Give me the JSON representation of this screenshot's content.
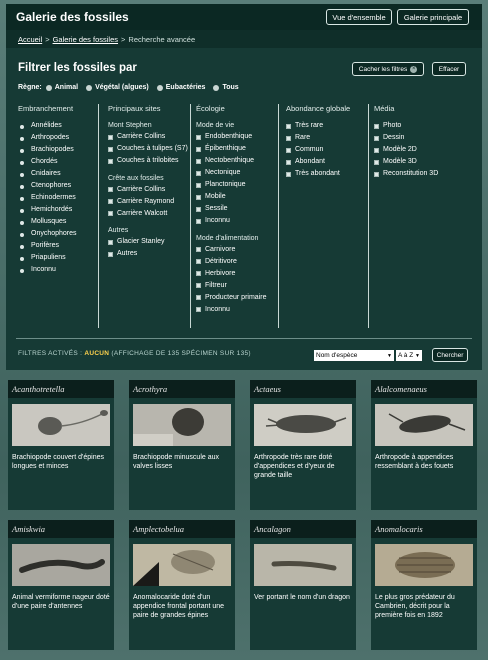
{
  "header": {
    "title": "Galerie des fossiles",
    "btn_overview": "Vue d'ensemble",
    "btn_main": "Galerie principale"
  },
  "breadcrumb": {
    "home": "Accueil",
    "sep1": ">",
    "gallery": "Galerie des fossiles",
    "sep2": ">",
    "current": "Recherche avancée"
  },
  "filter": {
    "title": "Filtrer les fossiles par",
    "hide_btn": "Cacher les filtres",
    "clear_btn": "Effacer",
    "regne_label": "Règne:",
    "regne_options": [
      "Animal",
      "Végétal (algues)",
      "Eubactéries",
      "Tous"
    ],
    "branchement": {
      "title": "Embranchement",
      "items": [
        "Annélides",
        "Arthropodes",
        "Brachiopodes",
        "Chordés",
        "Cnidaires",
        "Ctenophores",
        "Echinodermes",
        "Hemichordés",
        "Mollusques",
        "Onychophores",
        "Porifères",
        "Priapuliens",
        "Inconnu"
      ]
    },
    "sites": {
      "title": "Principaux sites",
      "group1": "Mont Stephen",
      "group1_items": [
        "Carrière Collins",
        "Couches à tulipes (S7)",
        "Couches à trilobites"
      ],
      "group2": "Crête aux fossiles",
      "group2_items": [
        "Carrière Collins",
        "Carrière Raymond",
        "Carrière Walcott"
      ],
      "group3": "Autres",
      "group3_items": [
        "Glacier Stanley",
        "Autres"
      ]
    },
    "ecologie": {
      "title": "Écologie",
      "group1": "Mode de vie",
      "group1_items": [
        "Endobenthique",
        "Épibenthique",
        "Nectobenthique",
        "Nectonique",
        "Planctonique",
        "Mobile",
        "Sessile",
        "Inconnu"
      ],
      "group2": "Mode d'alimentation",
      "group2_items": [
        "Carnivore",
        "Détritivore",
        "Herbivore",
        "Filtreur",
        "Producteur primaire",
        "Inconnu"
      ]
    },
    "abondance": {
      "title": "Abondance globale",
      "items": [
        "Très rare",
        "Rare",
        "Commun",
        "Abondant",
        "Très abondant"
      ]
    },
    "media": {
      "title": "Média",
      "items": [
        "Photo",
        "Dessin",
        "Modèle 2D",
        "Modèle 3D",
        "Reconstitution 3D"
      ]
    },
    "active_label": "FILTRES ACTIVÉS :",
    "active_value": "AUCUN",
    "active_count": "(AFFICHAGE DE 135 SPÉCIMEN SUR 135)",
    "sort_value": "Nom d'espèce",
    "sort_dir": "A à Z",
    "search_btn": "Chercher"
  },
  "cards": [
    {
      "name": "Acanthotretella",
      "desc": "Brachiopode couvert d'épines longues et minces"
    },
    {
      "name": "Acrothyra",
      "desc": "Brachiopode minuscule aux valves lisses"
    },
    {
      "name": "Actaeus",
      "desc": "Arthropode très rare doté d'appendices et d'yeux de grande taille"
    },
    {
      "name": "Alalcomenaeus",
      "desc": "Arthropode à appendices ressemblant à des fouets"
    },
    {
      "name": "Amiskwia",
      "desc": "Animal vermiforme nageur doté d'une paire d'antennes"
    },
    {
      "name": "Amplectobelua",
      "desc": "Anomalocaride doté d'un appendice frontal portant une paire de grandes épines"
    },
    {
      "name": "Ancalagon",
      "desc": "Ver portant le nom d'un dragon"
    },
    {
      "name": "Anomalocaris",
      "desc": "Le plus gros prédateur du Cambrien, décrit pour la première fois en 1892"
    }
  ],
  "colors": {
    "header": "#0b2823",
    "panel": "#163a35",
    "accent": "#ffd34d"
  }
}
